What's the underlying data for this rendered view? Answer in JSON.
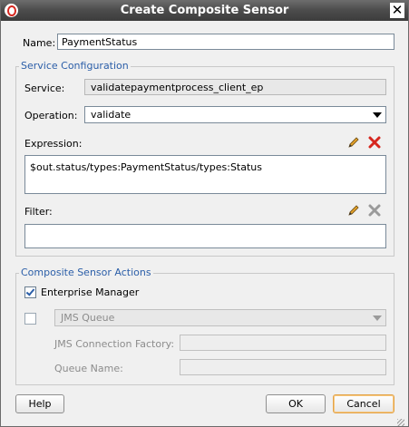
{
  "dialog": {
    "title": "Create Composite Sensor"
  },
  "name": {
    "label": "Name:",
    "value": "PaymentStatus"
  },
  "service_config": {
    "legend": "Service Configuration",
    "service_label": "Service:",
    "service_value": "validatepaymentprocess_client_ep",
    "operation_label": "Operation:",
    "operation_value": "validate",
    "expression_label": "Expression:",
    "expression_value": "$out.status/types:PaymentStatus/types:Status",
    "filter_label": "Filter:",
    "filter_value": ""
  },
  "actions": {
    "legend": "Composite Sensor Actions",
    "enterprise_manager_label": "Enterprise Manager",
    "enterprise_manager_checked": true,
    "jms_checked": false,
    "jms_type_value": "JMS Queue",
    "jms_factory_label": "JMS Connection Factory:",
    "queue_name_label": "Queue Name:"
  },
  "buttons": {
    "help": "Help",
    "ok": "OK",
    "cancel": "Cancel"
  },
  "icons": {
    "close": "close-icon",
    "edit": "pencil-icon",
    "delete": "delete-icon"
  },
  "colors": {
    "accent": "#2b5ea8",
    "delete_red": "#d6261e",
    "default_button_border": "#e3a349"
  }
}
